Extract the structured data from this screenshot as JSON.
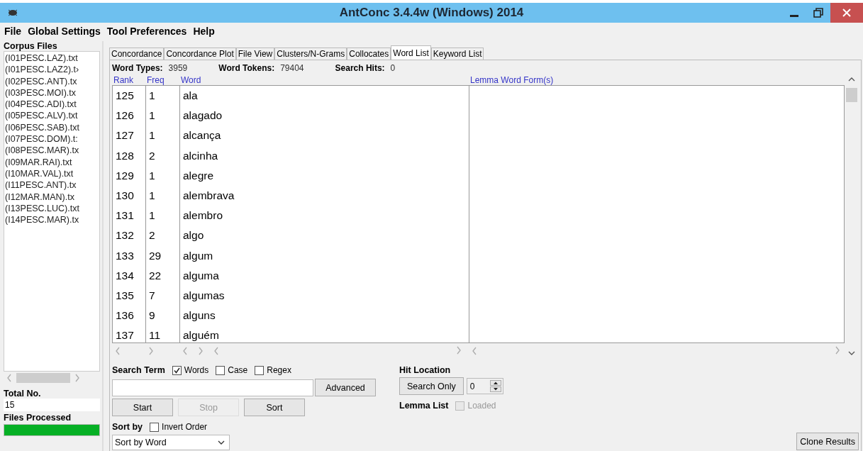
{
  "window": {
    "title": "AntConc 3.4.4w (Windows) 2014"
  },
  "menu": [
    "File",
    "Global Settings",
    "Tool Preferences",
    "Help"
  ],
  "corpus": {
    "label": "Corpus Files",
    "files": [
      "(I01PESC.LAZ).txt",
      "(I01PESC.LAZ2).t›",
      "(I02PESC.ANT).tx",
      "(I03PESC.MOI).tx",
      "(I04PESC.ADI).txt",
      "(I05PESC.ALV).txt",
      "(I06PESC.SAB).txt",
      "(I07PESC.DOM).t:",
      "(I08PESC.MAR).tx",
      "(I09MAR.RAI).txt",
      "(I10MAR.VAL).txt",
      "(I11PESC.ANT).tx",
      "(I12MAR.MAN).tx",
      "(I13PESC.LUC).txt",
      "(I14PESC.MAR).tx"
    ],
    "total_label": "Total No.",
    "total": "15",
    "processed_label": "Files Processed",
    "progress": {
      "level": 1
    }
  },
  "tabs": [
    {
      "label": "Concordance",
      "selected": false
    },
    {
      "label": "Concordance Plot",
      "selected": false
    },
    {
      "label": "File View",
      "selected": false
    },
    {
      "label": "Clusters/N-Grams",
      "selected": false
    },
    {
      "label": "Collocates",
      "selected": false
    },
    {
      "label": "Word List",
      "selected": true
    },
    {
      "label": "Keyword List",
      "selected": false
    }
  ],
  "stats": [
    {
      "label": "Word Types:",
      "value": "3959"
    },
    {
      "label": "Word Tokens:",
      "value": "79404"
    },
    {
      "label": "Search Hits:",
      "value": "0"
    }
  ],
  "table": {
    "columns": [
      "Rank",
      "Freq",
      "Word"
    ],
    "lemma_column": "Lemma Word Form(s)",
    "rows": [
      [
        "125",
        "1",
        "ala"
      ],
      [
        "126",
        "1",
        "alagado"
      ],
      [
        "127",
        "1",
        "alcança"
      ],
      [
        "128",
        "2",
        "alcinha"
      ],
      [
        "129",
        "1",
        "alegre"
      ],
      [
        "130",
        "1",
        "alembrava"
      ],
      [
        "131",
        "1",
        "alembro"
      ],
      [
        "132",
        "2",
        "algo"
      ],
      [
        "133",
        "29",
        "algum"
      ],
      [
        "134",
        "22",
        "alguma"
      ],
      [
        "135",
        "7",
        "algumas"
      ],
      [
        "136",
        "9",
        "alguns"
      ],
      [
        "137",
        "11",
        "alguém"
      ]
    ]
  },
  "search": {
    "label": "Search Term",
    "options": [
      {
        "label": "Words",
        "checked": true
      },
      {
        "label": "Case",
        "checked": false
      },
      {
        "label": "Regex",
        "checked": false
      }
    ],
    "advanced": "Advanced",
    "buttons": [
      {
        "label": "Start",
        "disabled": false
      },
      {
        "label": "Stop",
        "disabled": true
      },
      {
        "label": "Sort",
        "disabled": false
      }
    ]
  },
  "hit_location": {
    "label": "Hit Location",
    "button": "Search Only",
    "value": "0"
  },
  "lemma_list": {
    "label": "Lemma List",
    "checkbox": {
      "label": "Loaded",
      "checked": false,
      "disabled": true
    }
  },
  "sort_by": {
    "label": "Sort by",
    "invert": {
      "label": "Invert Order",
      "checked": false
    },
    "value": "Sort by Word"
  },
  "clone_button": "Clone Results"
}
